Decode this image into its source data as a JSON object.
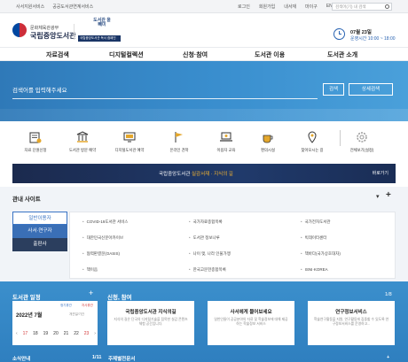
{
  "util": {
    "left_links": [
      "사서지원서비스",
      "공공도서관연계서비스"
    ],
    "right_links": [
      "로그인",
      "회원가입",
      "내서재",
      "마이구",
      "ENGLISH"
    ],
    "search_placeholder": "검색어(기) 내 검색"
  },
  "header": {
    "ministry": "문화체육관광부",
    "library_name": "국립중앙도서관",
    "campaign_title": "도서관 올빼미",
    "campaign_badge": "국립중앙도서관 독서 캠페인",
    "date": "07월 23일",
    "hours": "운영시간 10:00 ~ 18:00"
  },
  "nav": {
    "items": [
      "자료검색",
      "디지털컬렉션",
      "신청·참여",
      "도서관 이용",
      "도서관 소개"
    ]
  },
  "hero": {
    "search_placeholder": "검색어를 입력해주세요",
    "search_button": "검색",
    "advanced_button": "상세검색"
  },
  "quick": {
    "items": [
      {
        "label": "자료 단원신청",
        "icon": "book-form-icon"
      },
      {
        "label": "도서관 방문 예약",
        "icon": "museum-icon"
      },
      {
        "label": "디지털도서관 예약",
        "icon": "monitor-icon"
      },
      {
        "label": "온라인 견학",
        "icon": "flag-icon"
      },
      {
        "label": "이용자 교육",
        "icon": "laptop-icon"
      },
      {
        "label": "편의시설",
        "icon": "coffee-icon"
      },
      {
        "label": "찾아오시는 길",
        "icon": "map-pin-icon"
      },
      {
        "label": "전체보기(설정)",
        "icon": "gear-icon"
      }
    ]
  },
  "banner": {
    "prefix": "국립중앙도서관",
    "highlight": "실감서재 · 지식의 길",
    "more": "바로가기"
  },
  "related": {
    "title": "관내 사이트",
    "tabs": [
      "일반이용자",
      "사서·연구자",
      "출판사"
    ],
    "links": [
      "COVID-19도서관 서비스",
      "국가자료종합목록",
      "국가전자도서관",
      "대한민국신문아카이브",
      "도서관 정보나루",
      "빅데이터센터",
      "협력판결문(OASIS)",
      "나이 맺, 나라 인물가맹",
      "책바다(국가상호대차)",
      "책이음",
      "한국고문헌종합목록",
      "ISNI·KOREA"
    ]
  },
  "calendar": {
    "title": "도서관 일정",
    "month": "2022년 7월",
    "legend": [
      "정기휴관",
      "자사휴관",
      "개관일/기간"
    ],
    "days": [
      "17",
      "18",
      "19",
      "20",
      "21",
      "22",
      "23"
    ]
  },
  "participation": {
    "title": "신청, 참여",
    "count": "1/8",
    "cards": [
      {
        "title": "국립중앙도서관 지식의길",
        "desc": "지식의 길은 단국의 디지털기술을 접목한 실감 콘텐츠 체험 공간입니다."
      },
      {
        "title": "사서에게 물어보세요",
        "desc": "일반인들이 공공분야의 자료 및 학술정보에 대해 제공하는 학술정보 서비스"
      },
      {
        "title": "연구정보서비스",
        "desc": "학술연구활동을 지원, 연구활동에 집중할 수 있도록 연구정보서비스를 운영하고..."
      }
    ]
  },
  "bottom_labels": [
    "소식안내",
    "1/11",
    "주제별전문서",
    "+"
  ]
}
